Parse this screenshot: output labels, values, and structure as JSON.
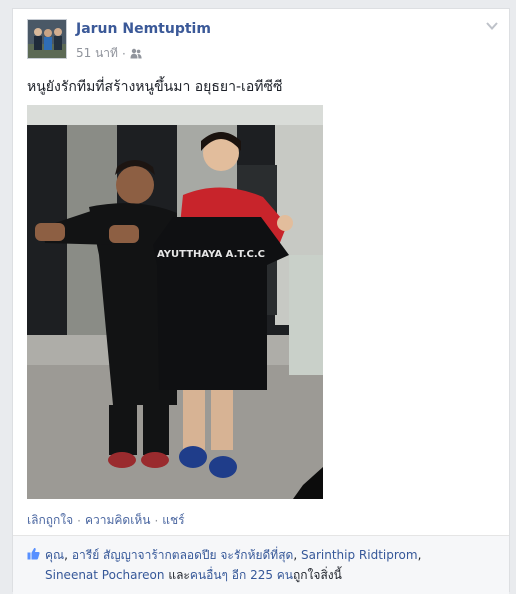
{
  "post": {
    "author": "Jarun Nemtuptim",
    "timestamp": "51 นาที",
    "privacy_icon": "friends-icon",
    "caption": "หนูยังรักทีมที่สร้างหนูขึ้นมา อยุธยา-เอทีซีซี",
    "photo": {
      "shirt_text": "AYUTTHAYA A.T.C.C"
    }
  },
  "actions": {
    "unlike": "เลิกถูกใจ",
    "comment": "ความคิดเห็น",
    "share": "แชร์",
    "separator": "·"
  },
  "likes": {
    "icon": "thumbs-up-icon",
    "you": "คุณ",
    "comma1": ", ",
    "person1": "อารีย์ สัญญาจาร้ากตลอดปีย จะรักห้ยดีที่สุด",
    "comma2": ", ",
    "person2": "Sarinthip Ridtiprom",
    "comma3": ",",
    "person3": "Sineenat Pochareon",
    "and_text": " และ",
    "others": "คนอื่นๆ อีก 225 คน",
    "suffix": "ถูกใจสิ่งนี้"
  },
  "colors": {
    "link": "#3b5998",
    "meta": "#90949c",
    "text": "#1d2129"
  }
}
